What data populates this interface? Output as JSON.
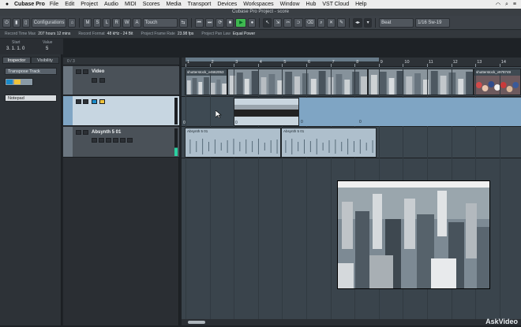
{
  "menubar": {
    "app_name": "Cubase Pro",
    "items": [
      "File",
      "Edit",
      "Project",
      "Audio",
      "MIDI",
      "Scores",
      "Media",
      "Transport",
      "Devices",
      "Workspaces",
      "Window",
      "Hub",
      "VST Cloud",
      "Help"
    ]
  },
  "window": {
    "title": "Cubase Pro Project - score"
  },
  "toolbar": {
    "configurations": "Configurations",
    "automation_mode": "Touch",
    "quantize": "Beat",
    "quantize_value": "1/16 Sw-19",
    "status_letters": [
      "M",
      "S",
      "L",
      "R",
      "W",
      "A"
    ]
  },
  "infoline": {
    "record_time_max_label": "Record Time Max",
    "record_time_max": "207 hours 12 mins",
    "record_format_label": "Record Format",
    "record_format": "48 kHz - 24 Bit",
    "frame_rate_label": "Project Frame Rate",
    "frame_rate": "23.98 fps",
    "pan_law_label": "Project Pan Law",
    "pan_law": "Equal Power"
  },
  "status": {
    "start_label": "Start",
    "start_value": "3. 1. 1.   0",
    "value_label": "Value",
    "value": "5"
  },
  "inspector": {
    "tabs": [
      "Inspector",
      "Visibility"
    ],
    "track_name": "Transpose Track",
    "preset": "Notepad"
  },
  "tracklist": {
    "header": "0 / 3",
    "tracks": [
      {
        "name": "Video"
      },
      {
        "name": ""
      },
      {
        "name": "Absynth 5 01"
      }
    ]
  },
  "ruler": {
    "bars": [
      "1",
      "2",
      "3",
      "4",
      "5",
      "6",
      "7",
      "8",
      "9",
      "10",
      "11",
      "12",
      "13",
      "14"
    ]
  },
  "clips": {
    "video_1": "shutterstock_v4662053",
    "video_2": "shutterstock_v978749",
    "transpose_values": [
      "0",
      "0",
      "0"
    ],
    "audio_1": "Absynth 5 01",
    "audio_2": "Absynth 5 01"
  },
  "watermark": "AskVideo",
  "colors": {
    "accent_green": "#3fb850",
    "transpose_clip": "#7fa5c4",
    "audio_clip": "#aebfcc",
    "instrument_icon": "#1b8bc9"
  }
}
